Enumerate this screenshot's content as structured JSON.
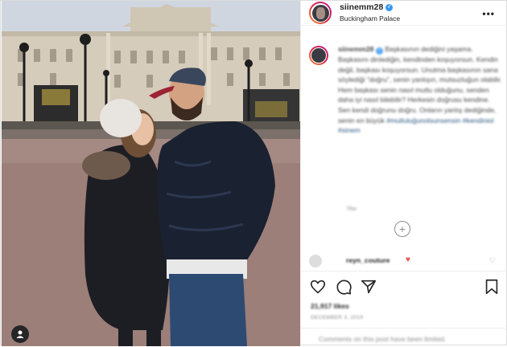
{
  "post": {
    "username": "siinemm28",
    "location": "Buckingham Palace",
    "more_icon": "more-horizontal-icon",
    "verified_icon": "verified-badge-icon"
  },
  "caption": {
    "username": "siinemm28",
    "text": "Başkasının dediğini yaşama. Başkasını dinlediğin, kendinden koşuyorsun. Kendin değil, başkası koşuyorsun. Unutma başkasının sana söylediği \"doğru\", senin yanlışın, mutsuzluğun olabilir. Hem başkası senin nasıl mutlu olduğunu, senden daha iyi nasıl bilebilir? Herkesin doğrusu kendine. Sen kendi doğrunu doğru. Onların yanlış dediğinde, senin en büyük",
    "tags": "#mutluluğunolsunsensin #kendiniol #sinem",
    "meta": "76w"
  },
  "comment": {
    "username": "reyn_couture",
    "emoji": "♥"
  },
  "actions": {
    "likes": "21,917 likes",
    "date": "DECEMBER 3, 2019",
    "add_comment": "Comments on this post have been limited."
  },
  "colors": {
    "accent": "#3897f0",
    "heart": "#ed4956",
    "muted": "#8e8e8e",
    "border": "#efefef"
  }
}
